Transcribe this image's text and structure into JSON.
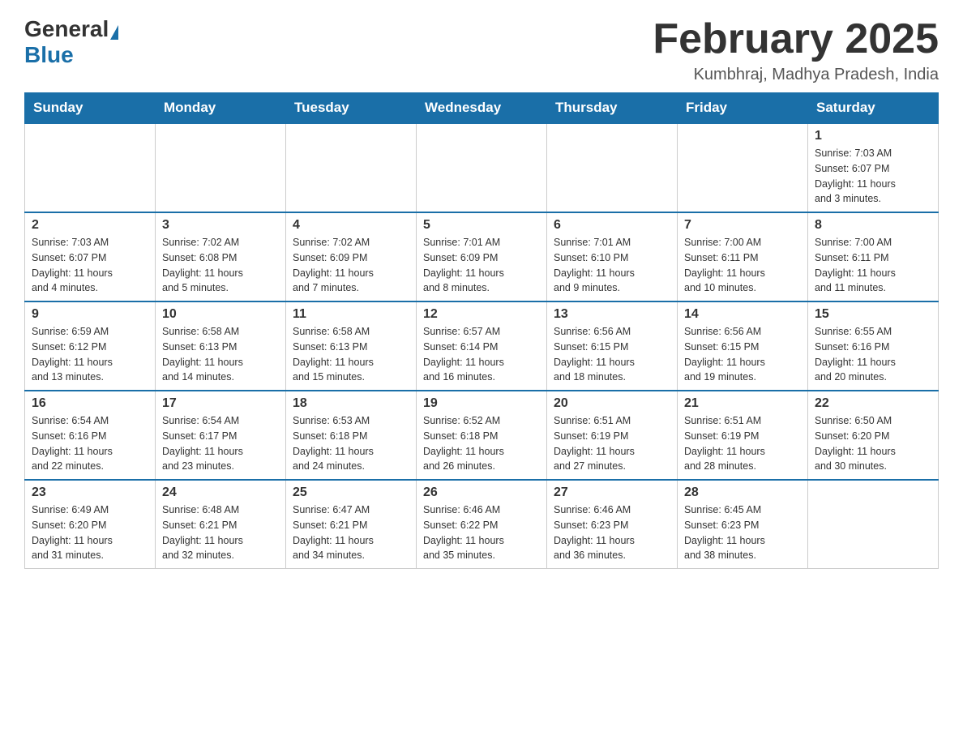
{
  "logo": {
    "general": "General",
    "blue": "Blue"
  },
  "header": {
    "month": "February 2025",
    "location": "Kumbhraj, Madhya Pradesh, India"
  },
  "weekdays": [
    "Sunday",
    "Monday",
    "Tuesday",
    "Wednesday",
    "Thursday",
    "Friday",
    "Saturday"
  ],
  "weeks": [
    [
      {
        "day": "",
        "info": ""
      },
      {
        "day": "",
        "info": ""
      },
      {
        "day": "",
        "info": ""
      },
      {
        "day": "",
        "info": ""
      },
      {
        "day": "",
        "info": ""
      },
      {
        "day": "",
        "info": ""
      },
      {
        "day": "1",
        "info": "Sunrise: 7:03 AM\nSunset: 6:07 PM\nDaylight: 11 hours\nand 3 minutes."
      }
    ],
    [
      {
        "day": "2",
        "info": "Sunrise: 7:03 AM\nSunset: 6:07 PM\nDaylight: 11 hours\nand 4 minutes."
      },
      {
        "day": "3",
        "info": "Sunrise: 7:02 AM\nSunset: 6:08 PM\nDaylight: 11 hours\nand 5 minutes."
      },
      {
        "day": "4",
        "info": "Sunrise: 7:02 AM\nSunset: 6:09 PM\nDaylight: 11 hours\nand 7 minutes."
      },
      {
        "day": "5",
        "info": "Sunrise: 7:01 AM\nSunset: 6:09 PM\nDaylight: 11 hours\nand 8 minutes."
      },
      {
        "day": "6",
        "info": "Sunrise: 7:01 AM\nSunset: 6:10 PM\nDaylight: 11 hours\nand 9 minutes."
      },
      {
        "day": "7",
        "info": "Sunrise: 7:00 AM\nSunset: 6:11 PM\nDaylight: 11 hours\nand 10 minutes."
      },
      {
        "day": "8",
        "info": "Sunrise: 7:00 AM\nSunset: 6:11 PM\nDaylight: 11 hours\nand 11 minutes."
      }
    ],
    [
      {
        "day": "9",
        "info": "Sunrise: 6:59 AM\nSunset: 6:12 PM\nDaylight: 11 hours\nand 13 minutes."
      },
      {
        "day": "10",
        "info": "Sunrise: 6:58 AM\nSunset: 6:13 PM\nDaylight: 11 hours\nand 14 minutes."
      },
      {
        "day": "11",
        "info": "Sunrise: 6:58 AM\nSunset: 6:13 PM\nDaylight: 11 hours\nand 15 minutes."
      },
      {
        "day": "12",
        "info": "Sunrise: 6:57 AM\nSunset: 6:14 PM\nDaylight: 11 hours\nand 16 minutes."
      },
      {
        "day": "13",
        "info": "Sunrise: 6:56 AM\nSunset: 6:15 PM\nDaylight: 11 hours\nand 18 minutes."
      },
      {
        "day": "14",
        "info": "Sunrise: 6:56 AM\nSunset: 6:15 PM\nDaylight: 11 hours\nand 19 minutes."
      },
      {
        "day": "15",
        "info": "Sunrise: 6:55 AM\nSunset: 6:16 PM\nDaylight: 11 hours\nand 20 minutes."
      }
    ],
    [
      {
        "day": "16",
        "info": "Sunrise: 6:54 AM\nSunset: 6:16 PM\nDaylight: 11 hours\nand 22 minutes."
      },
      {
        "day": "17",
        "info": "Sunrise: 6:54 AM\nSunset: 6:17 PM\nDaylight: 11 hours\nand 23 minutes."
      },
      {
        "day": "18",
        "info": "Sunrise: 6:53 AM\nSunset: 6:18 PM\nDaylight: 11 hours\nand 24 minutes."
      },
      {
        "day": "19",
        "info": "Sunrise: 6:52 AM\nSunset: 6:18 PM\nDaylight: 11 hours\nand 26 minutes."
      },
      {
        "day": "20",
        "info": "Sunrise: 6:51 AM\nSunset: 6:19 PM\nDaylight: 11 hours\nand 27 minutes."
      },
      {
        "day": "21",
        "info": "Sunrise: 6:51 AM\nSunset: 6:19 PM\nDaylight: 11 hours\nand 28 minutes."
      },
      {
        "day": "22",
        "info": "Sunrise: 6:50 AM\nSunset: 6:20 PM\nDaylight: 11 hours\nand 30 minutes."
      }
    ],
    [
      {
        "day": "23",
        "info": "Sunrise: 6:49 AM\nSunset: 6:20 PM\nDaylight: 11 hours\nand 31 minutes."
      },
      {
        "day": "24",
        "info": "Sunrise: 6:48 AM\nSunset: 6:21 PM\nDaylight: 11 hours\nand 32 minutes."
      },
      {
        "day": "25",
        "info": "Sunrise: 6:47 AM\nSunset: 6:21 PM\nDaylight: 11 hours\nand 34 minutes."
      },
      {
        "day": "26",
        "info": "Sunrise: 6:46 AM\nSunset: 6:22 PM\nDaylight: 11 hours\nand 35 minutes."
      },
      {
        "day": "27",
        "info": "Sunrise: 6:46 AM\nSunset: 6:23 PM\nDaylight: 11 hours\nand 36 minutes."
      },
      {
        "day": "28",
        "info": "Sunrise: 6:45 AM\nSunset: 6:23 PM\nDaylight: 11 hours\nand 38 minutes."
      },
      {
        "day": "",
        "info": ""
      }
    ]
  ]
}
